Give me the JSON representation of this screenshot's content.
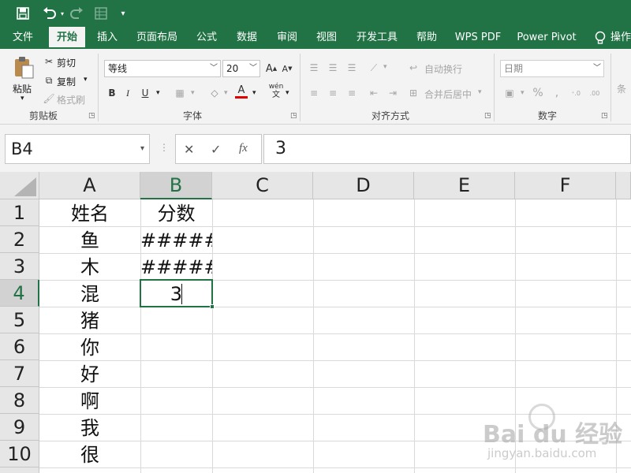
{
  "qat": {
    "save_icon": "save-icon",
    "undo_icon": "undo-icon",
    "redo_icon": "redo-icon",
    "form_icon": "form-icon",
    "customize_icon": "customize-icon"
  },
  "tabs": [
    {
      "label": "文件"
    },
    {
      "label": "开始"
    },
    {
      "label": "插入"
    },
    {
      "label": "页面布局"
    },
    {
      "label": "公式"
    },
    {
      "label": "数据"
    },
    {
      "label": "审阅"
    },
    {
      "label": "视图"
    },
    {
      "label": "开发工具"
    },
    {
      "label": "帮助"
    },
    {
      "label": "WPS PDF"
    },
    {
      "label": "Power Pivot"
    },
    {
      "label": "操作"
    }
  ],
  "active_tab": "开始",
  "ribbon": {
    "clipboard": {
      "paste": "粘贴",
      "cut": "剪切",
      "copy": "复制",
      "format_painter": "格式刷",
      "group": "剪贴板"
    },
    "font": {
      "font_name": "等线",
      "font_size": "20",
      "grow": "A",
      "shrink": "A",
      "bold": "B",
      "italic": "I",
      "underline": "U",
      "font_color": "A",
      "phonetic_top": "wén",
      "phonetic_bottom": "文",
      "group": "字体"
    },
    "alignment": {
      "wrap_text": "自动换行",
      "merge_center": "合并后居中",
      "group": "对齐方式"
    },
    "number": {
      "format": "日期",
      "percent": "%",
      "group": "数字"
    },
    "styles": {
      "conditional": "条"
    }
  },
  "formula_bar": {
    "name_box": "B4",
    "cancel": "✕",
    "enter": "✓",
    "fx": "fx",
    "content": "3"
  },
  "grid": {
    "columns": [
      "A",
      "B",
      "C",
      "D",
      "E",
      "F"
    ],
    "rows": [
      "1",
      "2",
      "3",
      "4",
      "5",
      "6",
      "7",
      "8",
      "9",
      "10"
    ],
    "selected_col": "B",
    "selected_row": "4",
    "cells": {
      "A1": "姓名",
      "B1": "分数",
      "A2": "鱼",
      "B2": "#####",
      "A3": "木",
      "B3": "#####",
      "A4": "混",
      "B4": "3",
      "A5": "猪",
      "A6": "你",
      "A7": "好",
      "A8": "啊",
      "A9": "我",
      "A10": "很"
    }
  },
  "watermark": {
    "brand": "Bai du 经验",
    "url": "jingyan.baidu.com"
  },
  "colors": {
    "accent": "#217346",
    "ribbon_bg": "#f3f3f3",
    "header_bg": "#e6e6e6",
    "gridline": "#d9d9d9"
  }
}
